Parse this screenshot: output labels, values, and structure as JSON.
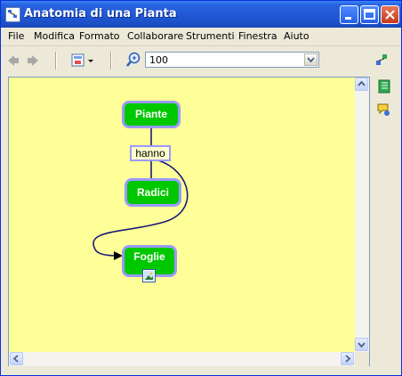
{
  "window": {
    "title": "Anatomia di una Pianta"
  },
  "menu": {
    "items": [
      {
        "label": "File"
      },
      {
        "label": "Modifica"
      },
      {
        "label": "Formato"
      },
      {
        "label": "Collaborare"
      },
      {
        "label": "Strumenti"
      },
      {
        "label": "Finestra"
      },
      {
        "label": "Aiuto"
      }
    ]
  },
  "toolbar": {
    "zoom_value": "100"
  },
  "map": {
    "concepts": [
      {
        "label": "Piante"
      },
      {
        "label": "Radici"
      },
      {
        "label": "Foglie"
      }
    ],
    "link_phrase": "hanno",
    "colors": {
      "background": "#FFFF99",
      "concept_fill": "#00C800",
      "concept_border": "#9A9AFF",
      "connector": "#1A1A7A"
    }
  }
}
